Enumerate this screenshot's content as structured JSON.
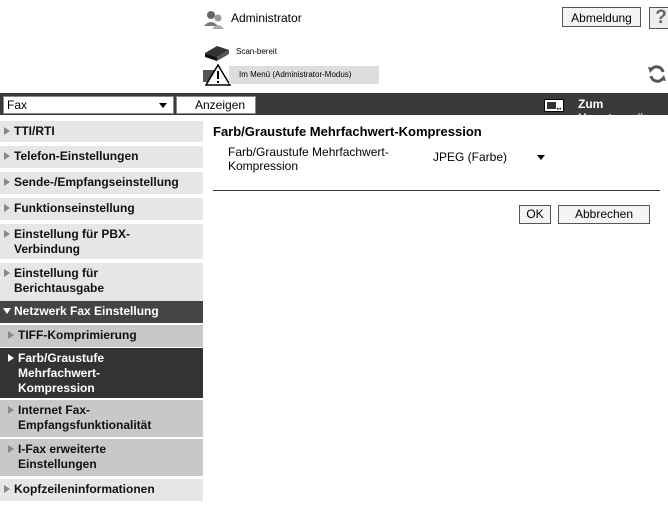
{
  "header": {
    "user_name": "Administrator",
    "logout_label": "Abmeldung",
    "help_label": "?",
    "scan_status": "Scan-bereit",
    "mode_status": "Im Menü (Administrator-Modus)"
  },
  "toolbar": {
    "mode_selected": "Fax",
    "display_label": "Anzeigen",
    "home_label": "Zum Hauptmenü"
  },
  "sidebar": {
    "items": [
      {
        "label": "TTI/RTI"
      },
      {
        "label": "Telefon-Einstellungen"
      },
      {
        "label": "Sende-/Empfangseinstellung"
      },
      {
        "label": "Funktionseinstellung"
      },
      {
        "label": "Einstellung für PBX-\nVerbindung"
      },
      {
        "label": "Einstellung für\nBerichtausgabe"
      },
      {
        "label": "Netzwerk Fax Einstellung"
      },
      {
        "label": "TIFF-Komprimierung"
      },
      {
        "label": "Farb/Graustufe\nMehrfachwert-\nKompression"
      },
      {
        "label": "Internet Fax-\nEmpfangsfunktionalität"
      },
      {
        "label": "I-Fax erweiterte\nEinstellungen"
      },
      {
        "label": "Kopfzeileninformationen"
      }
    ]
  },
  "content": {
    "title": "Farb/Graustufe Mehrfachwert-Kompression",
    "field_label": "Farb/Graustufe Mehrfachwert-\nKompression",
    "field_value": "JPEG (Farbe)",
    "ok_label": "OK",
    "cancel_label": "Abbrechen"
  }
}
